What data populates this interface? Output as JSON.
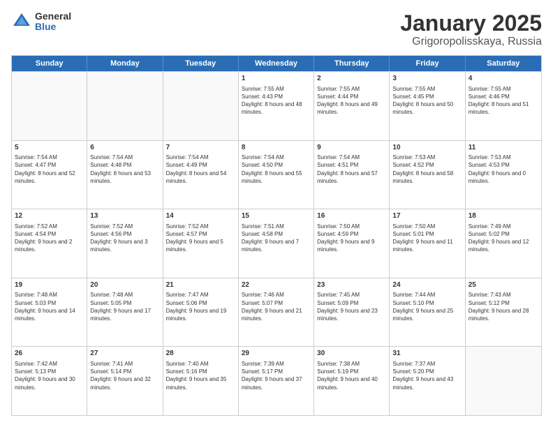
{
  "logo": {
    "general": "General",
    "blue": "Blue"
  },
  "title": {
    "month": "January 2025",
    "location": "Grigoropolisskaya, Russia"
  },
  "header": {
    "days": [
      "Sunday",
      "Monday",
      "Tuesday",
      "Wednesday",
      "Thursday",
      "Friday",
      "Saturday"
    ]
  },
  "rows": [
    [
      {
        "day": "",
        "info": "",
        "empty": true
      },
      {
        "day": "",
        "info": "",
        "empty": true
      },
      {
        "day": "",
        "info": "",
        "empty": true
      },
      {
        "day": "1",
        "info": "Sunrise: 7:55 AM\nSunset: 4:43 PM\nDaylight: 8 hours and 48 minutes.",
        "empty": false
      },
      {
        "day": "2",
        "info": "Sunrise: 7:55 AM\nSunset: 4:44 PM\nDaylight: 8 hours and 49 minutes.",
        "empty": false
      },
      {
        "day": "3",
        "info": "Sunrise: 7:55 AM\nSunset: 4:45 PM\nDaylight: 8 hours and 50 minutes.",
        "empty": false
      },
      {
        "day": "4",
        "info": "Sunrise: 7:55 AM\nSunset: 4:46 PM\nDaylight: 8 hours and 51 minutes.",
        "empty": false
      }
    ],
    [
      {
        "day": "5",
        "info": "Sunrise: 7:54 AM\nSunset: 4:47 PM\nDaylight: 8 hours and 52 minutes.",
        "empty": false
      },
      {
        "day": "6",
        "info": "Sunrise: 7:54 AM\nSunset: 4:48 PM\nDaylight: 8 hours and 53 minutes.",
        "empty": false
      },
      {
        "day": "7",
        "info": "Sunrise: 7:54 AM\nSunset: 4:49 PM\nDaylight: 8 hours and 54 minutes.",
        "empty": false
      },
      {
        "day": "8",
        "info": "Sunrise: 7:54 AM\nSunset: 4:50 PM\nDaylight: 8 hours and 55 minutes.",
        "empty": false
      },
      {
        "day": "9",
        "info": "Sunrise: 7:54 AM\nSunset: 4:51 PM\nDaylight: 8 hours and 57 minutes.",
        "empty": false
      },
      {
        "day": "10",
        "info": "Sunrise: 7:53 AM\nSunset: 4:52 PM\nDaylight: 8 hours and 58 minutes.",
        "empty": false
      },
      {
        "day": "11",
        "info": "Sunrise: 7:53 AM\nSunset: 4:53 PM\nDaylight: 9 hours and 0 minutes.",
        "empty": false
      }
    ],
    [
      {
        "day": "12",
        "info": "Sunrise: 7:52 AM\nSunset: 4:54 PM\nDaylight: 9 hours and 2 minutes.",
        "empty": false
      },
      {
        "day": "13",
        "info": "Sunrise: 7:52 AM\nSunset: 4:56 PM\nDaylight: 9 hours and 3 minutes.",
        "empty": false
      },
      {
        "day": "14",
        "info": "Sunrise: 7:52 AM\nSunset: 4:57 PM\nDaylight: 9 hours and 5 minutes.",
        "empty": false
      },
      {
        "day": "15",
        "info": "Sunrise: 7:51 AM\nSunset: 4:58 PM\nDaylight: 9 hours and 7 minutes.",
        "empty": false
      },
      {
        "day": "16",
        "info": "Sunrise: 7:50 AM\nSunset: 4:59 PM\nDaylight: 9 hours and 9 minutes.",
        "empty": false
      },
      {
        "day": "17",
        "info": "Sunrise: 7:50 AM\nSunset: 5:01 PM\nDaylight: 9 hours and 11 minutes.",
        "empty": false
      },
      {
        "day": "18",
        "info": "Sunrise: 7:49 AM\nSunset: 5:02 PM\nDaylight: 9 hours and 12 minutes.",
        "empty": false
      }
    ],
    [
      {
        "day": "19",
        "info": "Sunrise: 7:48 AM\nSunset: 5:03 PM\nDaylight: 9 hours and 14 minutes.",
        "empty": false
      },
      {
        "day": "20",
        "info": "Sunrise: 7:48 AM\nSunset: 5:05 PM\nDaylight: 9 hours and 17 minutes.",
        "empty": false
      },
      {
        "day": "21",
        "info": "Sunrise: 7:47 AM\nSunset: 5:06 PM\nDaylight: 9 hours and 19 minutes.",
        "empty": false
      },
      {
        "day": "22",
        "info": "Sunrise: 7:46 AM\nSunset: 5:07 PM\nDaylight: 9 hours and 21 minutes.",
        "empty": false
      },
      {
        "day": "23",
        "info": "Sunrise: 7:45 AM\nSunset: 5:09 PM\nDaylight: 9 hours and 23 minutes.",
        "empty": false
      },
      {
        "day": "24",
        "info": "Sunrise: 7:44 AM\nSunset: 5:10 PM\nDaylight: 9 hours and 25 minutes.",
        "empty": false
      },
      {
        "day": "25",
        "info": "Sunrise: 7:43 AM\nSunset: 5:12 PM\nDaylight: 9 hours and 28 minutes.",
        "empty": false
      }
    ],
    [
      {
        "day": "26",
        "info": "Sunrise: 7:42 AM\nSunset: 5:13 PM\nDaylight: 9 hours and 30 minutes.",
        "empty": false
      },
      {
        "day": "27",
        "info": "Sunrise: 7:41 AM\nSunset: 5:14 PM\nDaylight: 9 hours and 32 minutes.",
        "empty": false
      },
      {
        "day": "28",
        "info": "Sunrise: 7:40 AM\nSunset: 5:16 PM\nDaylight: 9 hours and 35 minutes.",
        "empty": false
      },
      {
        "day": "29",
        "info": "Sunrise: 7:39 AM\nSunset: 5:17 PM\nDaylight: 9 hours and 37 minutes.",
        "empty": false
      },
      {
        "day": "30",
        "info": "Sunrise: 7:38 AM\nSunset: 5:19 PM\nDaylight: 9 hours and 40 minutes.",
        "empty": false
      },
      {
        "day": "31",
        "info": "Sunrise: 7:37 AM\nSunset: 5:20 PM\nDaylight: 9 hours and 43 minutes.",
        "empty": false
      },
      {
        "day": "",
        "info": "",
        "empty": true
      }
    ]
  ]
}
